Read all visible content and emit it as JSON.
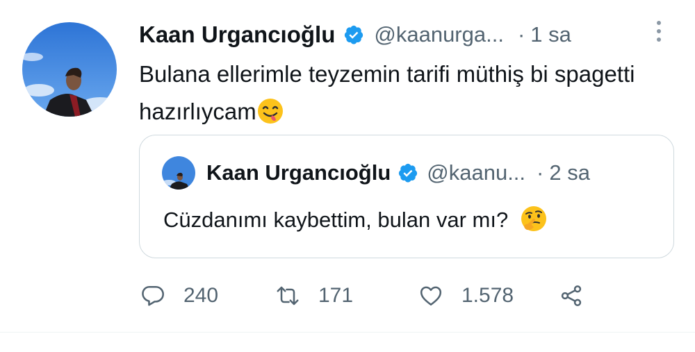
{
  "tweet": {
    "author_name": "Kaan Urgancıoğlu",
    "author_handle": "@kaanurga...",
    "dot": "·",
    "time": "1 sa",
    "text": "Bulana ellerimle teyzemin tarifi müthiş bi spagetti hazırlıycam",
    "text_emoji": "face-savoring-food-emoji"
  },
  "quoted": {
    "author_name": "Kaan Urgancıoğlu",
    "author_handle": "@kaanu...",
    "dot": "·",
    "time": "2 sa",
    "text": "Cüzdanımı kaybettim, bulan var mı?",
    "text_emoji": "thinking-face-emoji"
  },
  "actions": {
    "replies": "240",
    "retweets": "171",
    "likes": "1.578"
  },
  "colors": {
    "verified": "#1d9bf0",
    "secondary_text": "#536471",
    "border": "#cfd9de",
    "sky": "#3f86de"
  },
  "icons": [
    "verified-badge-icon",
    "more-options-icon",
    "reply-icon",
    "retweet-icon",
    "like-icon",
    "share-icon"
  ]
}
